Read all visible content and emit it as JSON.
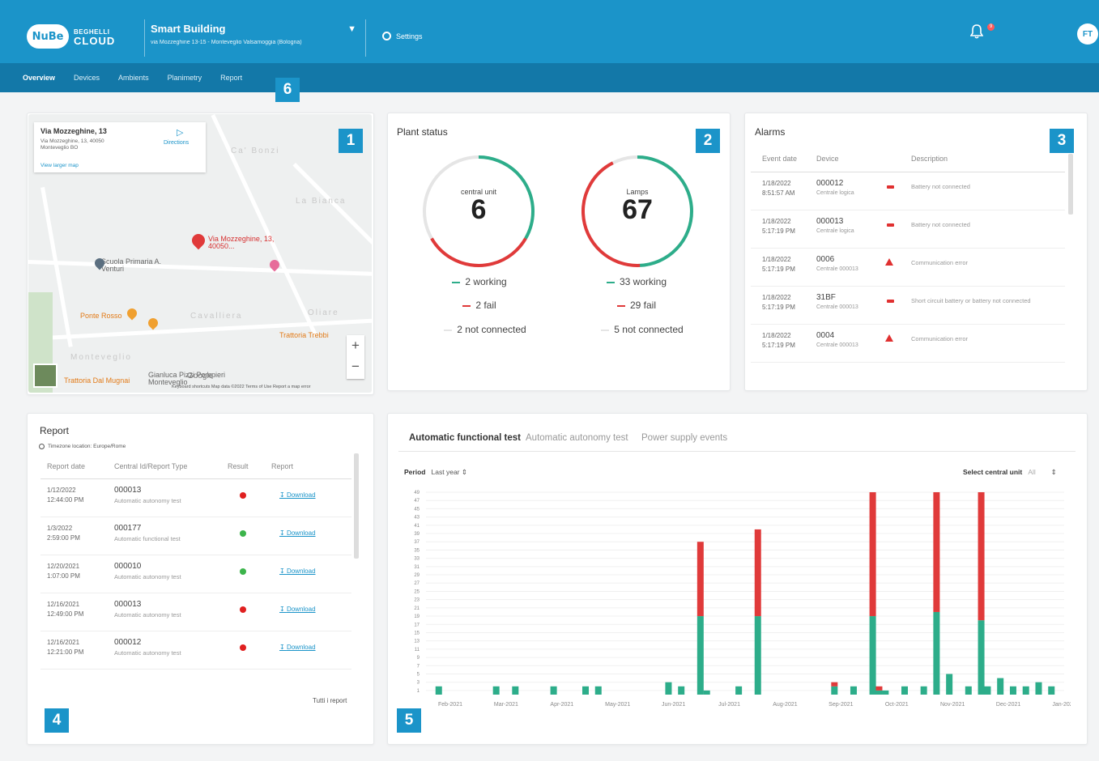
{
  "header": {
    "logo_mark": "NuBe",
    "logo_line1": "BEGHELLI",
    "logo_line2": "CLOUD",
    "building_name": "Smart Building",
    "building_address": "via Mozzeghine 13-15 - Monteveglio Valsamoggia (Bologna)",
    "settings_label": "Settings",
    "notifications_count": "9",
    "avatar_initials": "FT"
  },
  "nav": {
    "tabs": [
      "Overview",
      "Devices",
      "Ambients",
      "Planimetry",
      "Report"
    ],
    "active": "Overview"
  },
  "callouts": [
    "1",
    "2",
    "3",
    "4",
    "5",
    "6"
  ],
  "map": {
    "info_title": "Via Mozzeghine, 13",
    "info_address": "Via Mozzeghine, 13, 40050 Monteveglio BO",
    "directions_label": "Directions",
    "larger_map_label": "View larger map",
    "pin_label": "Via Mozzeghine, 13, 40050...",
    "places": [
      "Ca' Bonzi",
      "La Bianca",
      "Scuola Primaria A. Venturi",
      "Ponte Rosso",
      "Cavalliera",
      "Trattoria Trebbi",
      "Monteveglio",
      "Trattoria Dal Mugnai",
      "Gianluca Pizzi Pompieri Monteveglio",
      "Oliare"
    ],
    "footer": "Keyboard shortcuts   Map data ©2022   Terms of Use   Report a map error",
    "zoom_in": "+",
    "zoom_out": "−",
    "logo_text": "Google"
  },
  "plant": {
    "title": "Plant status",
    "central": {
      "label": "central unit",
      "value": "6",
      "working": "2 working",
      "fail": "2 fail",
      "not_connected": "2 not connected"
    },
    "lamps": {
      "label": "Lamps",
      "value": "67",
      "working": "33 working",
      "fail": "29 fail",
      "not_connected": "5 not connected"
    },
    "colors": {
      "working": "#2dad8a",
      "fail": "#e03a3a",
      "not_connected": "#e5e5e5"
    }
  },
  "alarms": {
    "title": "Alarms",
    "columns": [
      "Event date",
      "Device",
      "Description"
    ],
    "rows": [
      {
        "date": "1/18/2022",
        "time": "8:51:57 AM",
        "device": "000012",
        "sub": "Centrale logica",
        "icon": "battery",
        "desc": "Battery not connected"
      },
      {
        "date": "1/18/2022",
        "time": "5:17:19 PM",
        "device": "000013",
        "sub": "Centrale logica",
        "icon": "battery",
        "desc": "Battery not connected"
      },
      {
        "date": "1/18/2022",
        "time": "5:17:19 PM",
        "device": "0006",
        "sub": "Centrale 000013",
        "icon": "warning",
        "desc": "Communication error"
      },
      {
        "date": "1/18/2022",
        "time": "5:17:19 PM",
        "device": "31BF",
        "sub": "Centrale 000013",
        "icon": "battery",
        "desc": "Short circuit battery or battery not connected"
      },
      {
        "date": "1/18/2022",
        "time": "5:17:19 PM",
        "device": "0004",
        "sub": "Centrale 000013",
        "icon": "warning",
        "desc": "Communication error"
      }
    ]
  },
  "report": {
    "title": "Report",
    "timezone": "Timezone location: Europe/Rome",
    "columns": [
      "Report date",
      "Central Id/Report Type",
      "Result",
      "Report"
    ],
    "rows": [
      {
        "date": "1/12/2022",
        "time": "12:44:00 PM",
        "id": "000013",
        "type": "Automatic autonomy test",
        "result": "fail",
        "link": "Download"
      },
      {
        "date": "1/3/2022",
        "time": "2:59:00 PM",
        "id": "000177",
        "type": "Automatic functional test",
        "result": "ok",
        "link": "Download"
      },
      {
        "date": "12/20/2021",
        "time": "1:07:00 PM",
        "id": "000010",
        "type": "Automatic autonomy test",
        "result": "ok",
        "link": "Download"
      },
      {
        "date": "12/16/2021",
        "time": "12:49:00 PM",
        "id": "000013",
        "type": "Automatic autonomy test",
        "result": "fail",
        "link": "Download"
      },
      {
        "date": "12/16/2021",
        "time": "12:21:00 PM",
        "id": "000012",
        "type": "Automatic autonomy test",
        "result": "fail",
        "link": "Download"
      }
    ],
    "all_reports": "Tutti i report",
    "colors": {
      "ok": "#3cb44b",
      "fail": "#e02020"
    }
  },
  "tests": {
    "tabs": [
      "Automatic functional test",
      "Automatic autonomy test",
      "Power supply events"
    ],
    "active_tab": "Automatic functional test",
    "period_label": "Period",
    "period_value": "Last year",
    "central_label": "Select central unit",
    "central_value": "All"
  },
  "chart_data": {
    "type": "bar",
    "stacked": true,
    "ylim": [
      0,
      49
    ],
    "yticks": [
      1,
      3,
      5,
      7,
      9,
      11,
      13,
      15,
      17,
      19,
      21,
      23,
      25,
      27,
      29,
      31,
      33,
      35,
      37,
      39,
      41,
      43,
      45,
      47,
      49
    ],
    "xticks": [
      "Feb-2021",
      "Mar-2021",
      "Apr-2021",
      "May-2021",
      "Jun-2021",
      "Jul-2021",
      "Aug-2021",
      "Sep-2021",
      "Oct-2021",
      "Nov-2021",
      "Dec-2021",
      "Jan-2022"
    ],
    "colors": {
      "pass": "#2dad8a",
      "fail": "#e03a3a"
    },
    "bars": [
      {
        "t": 0.02,
        "pass": 2,
        "fail": 0
      },
      {
        "t": 0.11,
        "pass": 2,
        "fail": 0
      },
      {
        "t": 0.14,
        "pass": 2,
        "fail": 0
      },
      {
        "t": 0.2,
        "pass": 2,
        "fail": 0
      },
      {
        "t": 0.25,
        "pass": 2,
        "fail": 0
      },
      {
        "t": 0.27,
        "pass": 2,
        "fail": 0
      },
      {
        "t": 0.38,
        "pass": 3,
        "fail": 0
      },
      {
        "t": 0.4,
        "pass": 2,
        "fail": 0
      },
      {
        "t": 0.43,
        "pass": 19,
        "fail": 18
      },
      {
        "t": 0.44,
        "pass": 1,
        "fail": 0
      },
      {
        "t": 0.49,
        "pass": 2,
        "fail": 0
      },
      {
        "t": 0.52,
        "pass": 19,
        "fail": 21
      },
      {
        "t": 0.64,
        "pass": 2,
        "fail": 1
      },
      {
        "t": 0.67,
        "pass": 2,
        "fail": 0
      },
      {
        "t": 0.7,
        "pass": 19,
        "fail": 30
      },
      {
        "t": 0.71,
        "pass": 1,
        "fail": 1
      },
      {
        "t": 0.72,
        "pass": 1,
        "fail": 0
      },
      {
        "t": 0.75,
        "pass": 2,
        "fail": 0
      },
      {
        "t": 0.78,
        "pass": 2,
        "fail": 0
      },
      {
        "t": 0.8,
        "pass": 20,
        "fail": 29
      },
      {
        "t": 0.82,
        "pass": 5,
        "fail": 0
      },
      {
        "t": 0.85,
        "pass": 2,
        "fail": 0
      },
      {
        "t": 0.87,
        "pass": 18,
        "fail": 31
      },
      {
        "t": 0.88,
        "pass": 2,
        "fail": 0
      },
      {
        "t": 0.9,
        "pass": 4,
        "fail": 0
      },
      {
        "t": 0.92,
        "pass": 2,
        "fail": 0
      },
      {
        "t": 0.94,
        "pass": 2,
        "fail": 0
      },
      {
        "t": 0.96,
        "pass": 3,
        "fail": 0
      },
      {
        "t": 0.98,
        "pass": 2,
        "fail": 0
      }
    ]
  }
}
